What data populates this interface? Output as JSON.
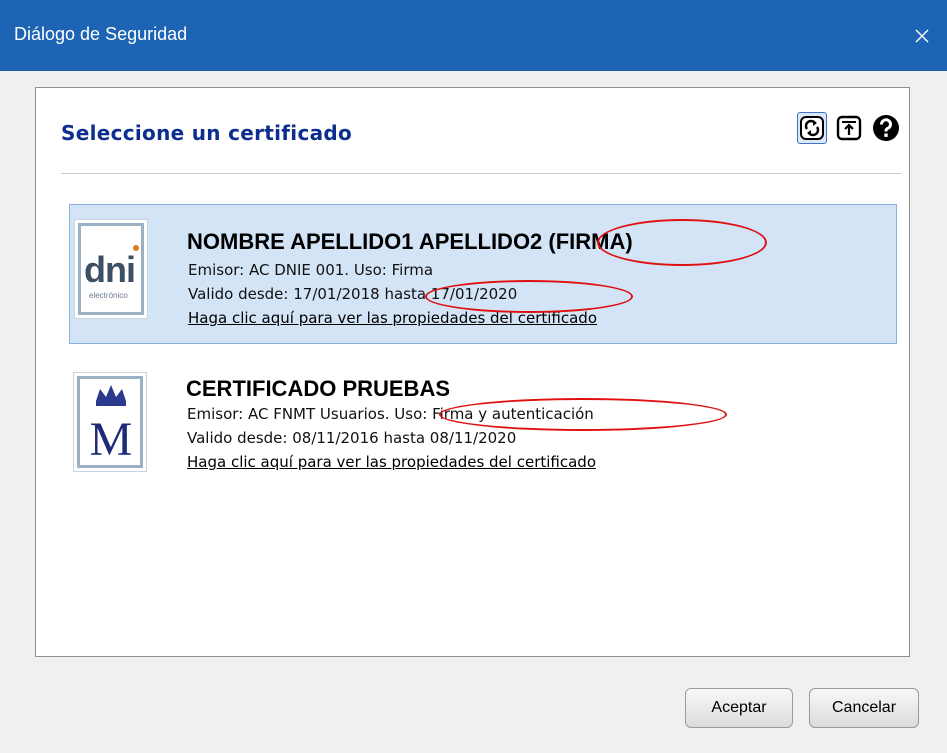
{
  "window": {
    "title": "Diálogo de Seguridad",
    "close_glyph": "✕"
  },
  "panel": {
    "heading": "Seleccione un certificado"
  },
  "toolbar": {
    "refresh_icon": "refresh-icon",
    "import_icon": "import-icon",
    "help_icon": "help-icon"
  },
  "certificates": [
    {
      "name": "NOMBRE APELLIDO1 APELLIDO2 (FIRMA)",
      "issuer_line": "Emisor: AC DNIE 001. Uso: Firma",
      "validity_line": "Valido desde: 17/01/2018 hasta 17/01/2020",
      "link": "Haga clic aquí para ver las propiedades del certificado",
      "logo_text": "dni",
      "logo_subtext": "electrónico",
      "selected": true
    },
    {
      "name": "CERTIFICADO PRUEBAS",
      "issuer_line": "Emisor: AC FNMT Usuarios. Uso: Firma y autenticación",
      "validity_line": "Valido desde: 08/11/2016 hasta 08/11/2020",
      "link": "Haga clic aquí para ver las propiedades del certificado",
      "logo_text": "M",
      "selected": false
    }
  ],
  "buttons": {
    "accept": "Aceptar",
    "cancel": "Cancelar"
  },
  "colors": {
    "titlebar": "#1e64b4",
    "heading": "#0d2e8e",
    "selection": "#d4e4f7",
    "annotation": "#e01010"
  }
}
